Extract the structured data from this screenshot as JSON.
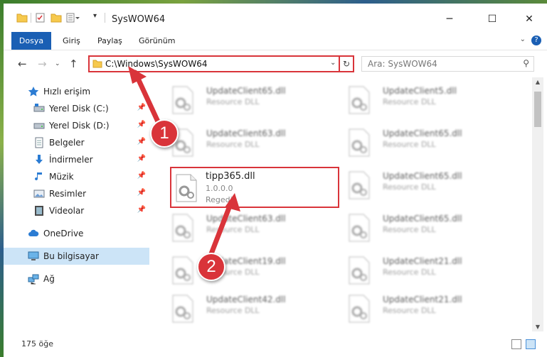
{
  "window": {
    "title": "SysWOW64",
    "minimize": "─",
    "maximize": "☐",
    "close": "✕"
  },
  "ribbon": {
    "tabs": [
      "Dosya",
      "Giriş",
      "Paylaş",
      "Görünüm"
    ],
    "help": "?"
  },
  "address": {
    "path": "C:\\Windows\\SysWOW64",
    "search_placeholder": "Ara: SysWOW64"
  },
  "sidebar": {
    "items": [
      {
        "label": "Hızlı erişim",
        "icon": "star-icon"
      },
      {
        "label": "Yerel Disk (C:)",
        "icon": "drive-icon"
      },
      {
        "label": "Yerel Disk (D:)",
        "icon": "drive-icon"
      },
      {
        "label": "Belgeler",
        "icon": "documents-icon"
      },
      {
        "label": "İndirmeler",
        "icon": "download-icon"
      },
      {
        "label": "Müzik",
        "icon": "music-icon"
      },
      {
        "label": "Resimler",
        "icon": "pictures-icon"
      },
      {
        "label": "Videolar",
        "icon": "videos-icon"
      },
      {
        "label": "OneDrive",
        "icon": "cloud-icon"
      },
      {
        "label": "Bu bilgisayar",
        "icon": "computer-icon"
      },
      {
        "label": "Ağ",
        "icon": "network-icon"
      }
    ]
  },
  "files": {
    "left": [
      {
        "name": "UpdateClient65.dll",
        "desc": "Resource DLL"
      },
      {
        "name": "UpdateClient63.dll",
        "desc": "Resource DLL"
      },
      {
        "name": "tipp365.dll",
        "desc": "1.0.0.0",
        "extra": "Regedit"
      },
      {
        "name": "UpdateClient63.dll",
        "desc": "Resource DLL"
      },
      {
        "name": "UpdateClient19.dll",
        "desc": "Resource DLL"
      },
      {
        "name": "UpdateClient42.dll",
        "desc": "Resource DLL"
      }
    ],
    "right": [
      {
        "name": "UpdateClient5.dll",
        "desc": "Resource DLL"
      },
      {
        "name": "UpdateClient65.dll",
        "desc": "Resource DLL"
      },
      {
        "name": "UpdateClient65.dll",
        "desc": "Resource DLL"
      },
      {
        "name": "UpdateClient65.dll",
        "desc": "Resource DLL"
      },
      {
        "name": "UpdateClient21.dll",
        "desc": "Resource DLL"
      },
      {
        "name": "UpdateClient21.dll",
        "desc": "Resource DLL"
      }
    ]
  },
  "status": {
    "count": "175 öğe"
  },
  "annotations": {
    "badge1": "1",
    "badge2": "2",
    "color": "#d9343a"
  }
}
